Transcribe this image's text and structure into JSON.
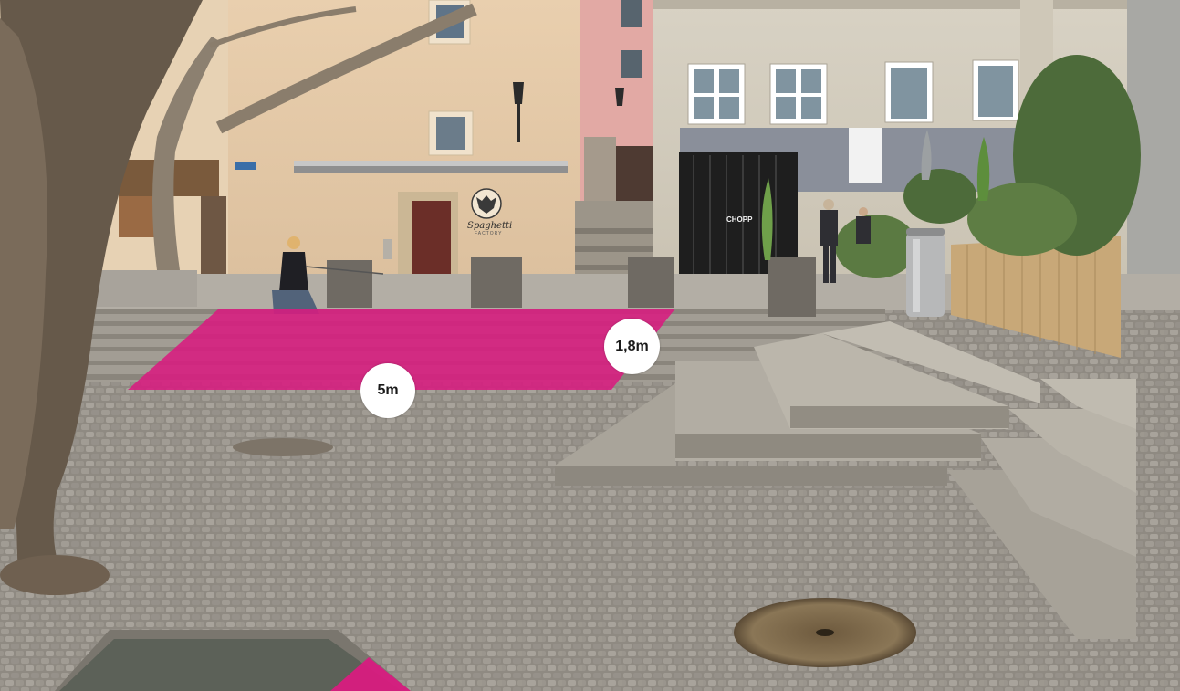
{
  "overlay": {
    "zone_color": "#d81b7f",
    "width_label": "5m",
    "height_label": "1,8m"
  },
  "signs": {
    "restaurant_name": "Spaghetti",
    "restaurant_subtitle": "FACTORY",
    "bar_sign": "CHOPP"
  },
  "scene": {
    "subject": "cobblestone-square-with-steps",
    "icons": [
      "tree",
      "street-lamp",
      "trash-bin",
      "manhole-cover",
      "person",
      "closed-parasol",
      "reed-fence",
      "plants"
    ]
  }
}
